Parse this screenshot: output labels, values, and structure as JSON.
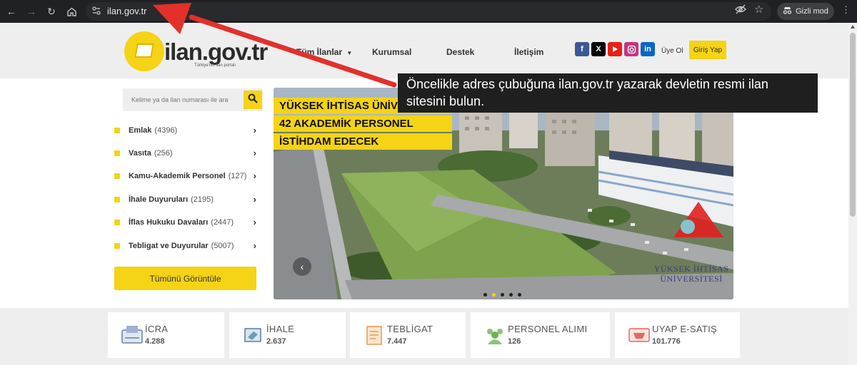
{
  "browser": {
    "url": "ilan.gov.tr",
    "incognito_label": "Gizli mod"
  },
  "site": {
    "logo_text": "ilan.gov.tr",
    "logo_subtitle": "Türkiye'nin ilan portalı",
    "nav": [
      "Tüm İlanlar",
      "Kurumsal",
      "Destek",
      "İletişim"
    ],
    "social_icons": [
      "facebook-icon",
      "x-icon",
      "youtube-icon",
      "instagram-icon",
      "linkedin-icon"
    ],
    "register": "Üye Ol",
    "login": "Giriş Yap"
  },
  "search": {
    "placeholder": "Kelime ya da ilan numarası ile ara"
  },
  "categories": [
    {
      "label": "Emlak",
      "count": "(4396)"
    },
    {
      "label": "Vasıta",
      "count": "(256)"
    },
    {
      "label": "Kamu-Akademik Personel",
      "count": "(127)"
    },
    {
      "label": "İhale Duyuruları",
      "count": "(2195)"
    },
    {
      "label": "İflas Hukuku Davaları",
      "count": "(2447)"
    },
    {
      "label": "Tebligat ve Duyurular",
      "count": "(5007)"
    }
  ],
  "view_all": "Tümünü Görüntüle",
  "banner": {
    "caption": [
      "YÜKSEK İHTİSAS ÜNİVERSİTESİ",
      "42 AKADEMİK PERSONEL",
      "İSTİHDAM EDECEK"
    ],
    "watermark": [
      "YÜKSEK İHTİSAS",
      "ÜNİVERSİTESİ"
    ],
    "slides_total": 5,
    "active_slide": 2
  },
  "callout": "Öncelikle adres çubuğuna ilan.gov.tr yazarak devletin resmi ilan sitesini bulun.",
  "stats": [
    {
      "title": "İCRA",
      "value": "4.288",
      "icon": "icra-icon"
    },
    {
      "title": "İHALE",
      "value": "2.637",
      "icon": "ihale-icon"
    },
    {
      "title": "TEBLİGAT",
      "value": "7.447",
      "icon": "tebligat-icon"
    },
    {
      "title": "PERSONEL ALIMI",
      "value": "126",
      "icon": "personel-icon"
    },
    {
      "title": "UYAP E-SATIŞ",
      "value": "101.776",
      "icon": "uyap-icon"
    }
  ],
  "colors": {
    "brand_yellow": "#f5d315",
    "annotation_red": "#e3302a",
    "callout_bg": "#1f1f1f"
  }
}
